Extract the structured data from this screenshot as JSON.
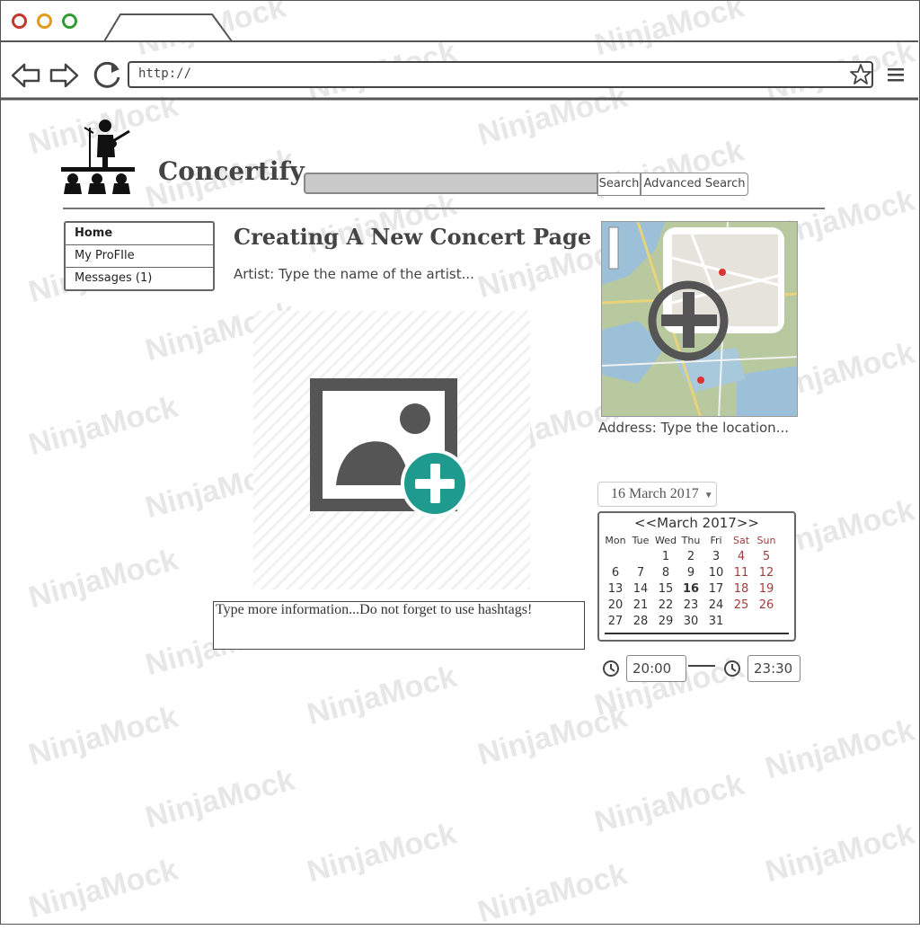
{
  "browser": {
    "url": "http://"
  },
  "site": {
    "title": "Concertify",
    "search_button": "Search",
    "advanced_search_button": "Advanced Search"
  },
  "nav": {
    "items": [
      {
        "label": "Home"
      },
      {
        "label": "My ProFIle"
      },
      {
        "label": "Messages (1)"
      }
    ]
  },
  "main": {
    "heading": "Creating A New Concert Page",
    "artist_placeholder": "Artist: Type the name of the artist...",
    "info_placeholder": "Type more information...Do not forget to use hashtags!"
  },
  "map": {
    "address_placeholder": "Address: Type the location..."
  },
  "date_picker": {
    "selected": "16 March 2017",
    "header": "<<March 2017>>",
    "days_of_week": [
      "Mon",
      "Tue",
      "Wed",
      "Thu",
      "Fri",
      "Sat",
      "Sun"
    ],
    "weeks": [
      [
        "",
        "",
        "1",
        "2",
        "3",
        "4",
        "5"
      ],
      [
        "6",
        "7",
        "8",
        "9",
        "10",
        "11",
        "12"
      ],
      [
        "13",
        "14",
        "15",
        "16",
        "17",
        "18",
        "19"
      ],
      [
        "20",
        "21",
        "22",
        "23",
        "24",
        "25",
        "26"
      ],
      [
        "27",
        "28",
        "29",
        "30",
        "31",
        "",
        ""
      ]
    ],
    "today": "16"
  },
  "time": {
    "start": "20:00",
    "end": "23:30"
  },
  "watermark": "NinjaMock",
  "colors": {
    "close": "#c0392b",
    "minimize": "#e39a1d",
    "maximize": "#2e9e33",
    "weekend": "#a23c3c",
    "upload_plus": "#1f9a8e"
  }
}
